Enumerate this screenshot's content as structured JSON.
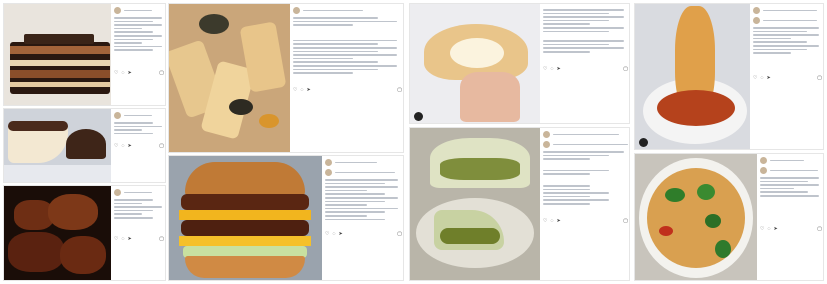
{
  "icons": {
    "heart": "♡",
    "comment": "◌",
    "share": "➤",
    "bookmark": "▢",
    "more": "⋯"
  },
  "colors": {
    "background": "#ffffff",
    "panel_border": "#e6e6e6",
    "text_line": "#bfc4cc"
  },
  "posts": [
    {
      "id": "cake-slice"
    },
    {
      "id": "cheesecake"
    },
    {
      "id": "grilled-meat"
    },
    {
      "id": "pasta-closeup"
    },
    {
      "id": "burger"
    },
    {
      "id": "pastry-hand"
    },
    {
      "id": "pistachio-tart"
    },
    {
      "id": "spaghetti-fork"
    },
    {
      "id": "spaghetti-plate"
    }
  ]
}
